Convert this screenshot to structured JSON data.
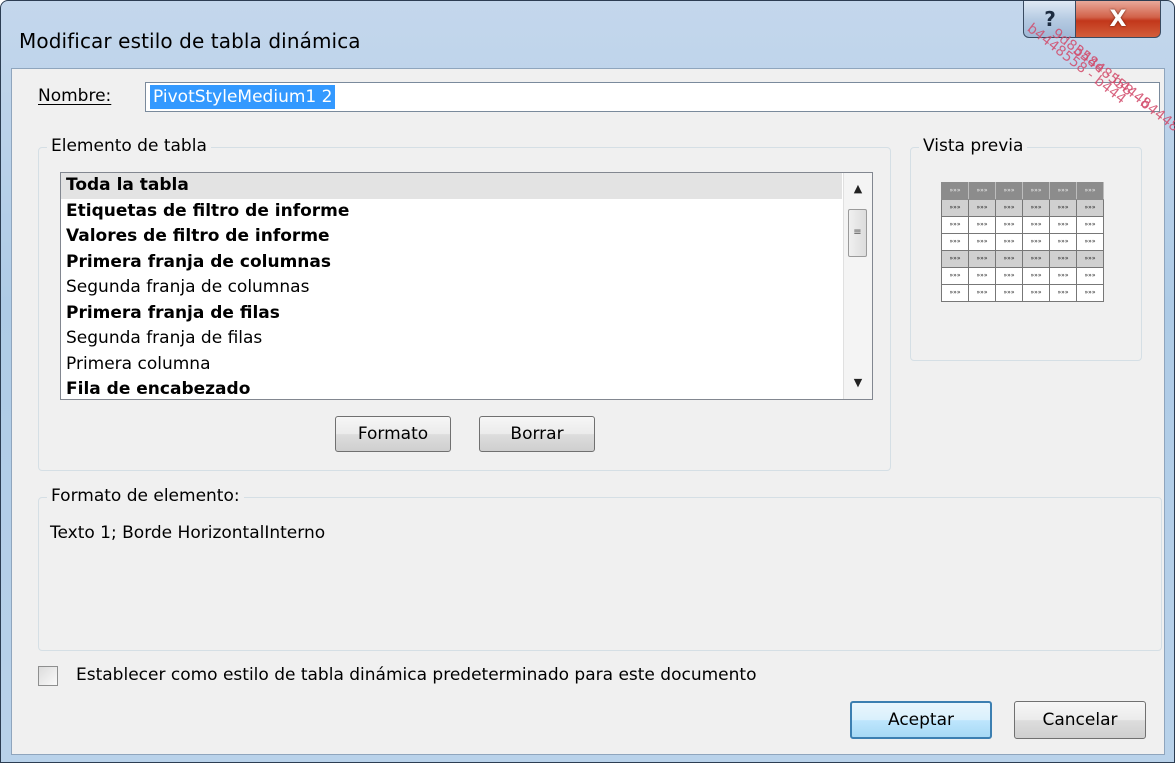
{
  "window": {
    "title": "Modificar estilo de tabla dinámica",
    "help_label": "?",
    "close_label": "X"
  },
  "name_field": {
    "label": "Nombre:",
    "value": "PivotStyleMedium1 2"
  },
  "table_element": {
    "group_label": "Elemento de tabla",
    "items": [
      {
        "label": "Toda la tabla",
        "bold": true,
        "selected": true
      },
      {
        "label": "Etiquetas de filtro de informe",
        "bold": true
      },
      {
        "label": "Valores de filtro de informe",
        "bold": true
      },
      {
        "label": "Primera franja de columnas",
        "bold": true
      },
      {
        "label": "Segunda franja de columnas",
        "bold": false
      },
      {
        "label": "Primera franja de filas",
        "bold": true
      },
      {
        "label": "Segunda franja de filas",
        "bold": false
      },
      {
        "label": "Primera columna",
        "bold": false
      },
      {
        "label": "Fila de encabezado",
        "bold": true
      }
    ],
    "format_button": "Formato",
    "clear_button": "Borrar"
  },
  "preview": {
    "label": "Vista previa",
    "cell_text": "»»»"
  },
  "element_format": {
    "label": "Formato de elemento:",
    "description": "Texto 1; Borde HorizontalInterno"
  },
  "default_checkbox": {
    "label": "Establecer como estilo de tabla dinámica predeterminado para este documento",
    "checked": false
  },
  "footer": {
    "ok_button": "Aceptar",
    "cancel_button": "Cancelar"
  },
  "watermark": {
    "lines": [
      "b4448558 - b444",
      "9d8358e - b4448",
      "b4448558 - b4448"
    ]
  }
}
